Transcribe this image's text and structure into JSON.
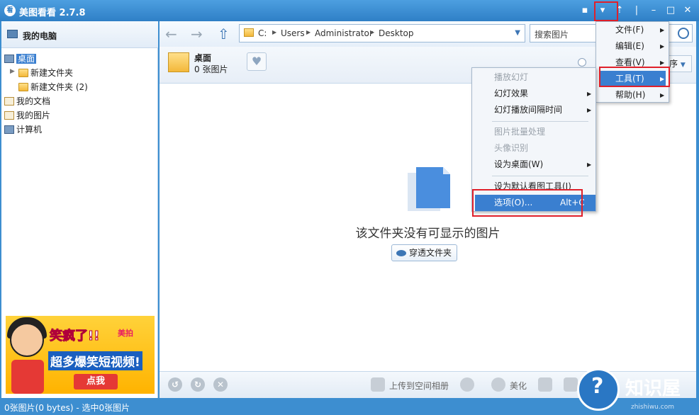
{
  "titlebar": {
    "app_icon_text": "看",
    "title": "美图看看 2.7.8"
  },
  "sidebar": {
    "header": "我的电脑",
    "items": [
      {
        "label": "桌面"
      },
      {
        "label": "新建文件夹"
      },
      {
        "label": "新建文件夹 (2)"
      },
      {
        "label": "我的文档"
      },
      {
        "label": "我的图片"
      },
      {
        "label": "计算机"
      }
    ],
    "ad": {
      "headline": "笑疯了!!",
      "brand": "美拍",
      "tagline": "超多爆笑短视频!",
      "button": "点我"
    }
  },
  "navbar": {
    "path": [
      "C:",
      "Users",
      "Administrator",
      "Desktop"
    ],
    "search_placeholder": "搜索图片"
  },
  "info": {
    "location_name": "桌面",
    "location_count": "0 张图片",
    "sort_label": "序"
  },
  "content": {
    "empty_message": "该文件夹没有可显示的图片",
    "traverse_button": "穿透文件夹"
  },
  "bottombar": {
    "upload_label": "上传到空间相册",
    "beautify_label": "美化"
  },
  "status": {
    "text": "0张图片(0 bytes) - 选中0张图片"
  },
  "main_menu": [
    {
      "label": "文件(F)"
    },
    {
      "label": "编辑(E)"
    },
    {
      "label": "查看(V)"
    },
    {
      "label": "工具(T)"
    },
    {
      "label": "帮助(H)"
    }
  ],
  "tools_menu": [
    {
      "label": "播放幻灯"
    },
    {
      "label": "幻灯效果"
    },
    {
      "label": "幻灯播放间隔时间"
    },
    {
      "label": "图片批量处理"
    },
    {
      "label": "头像识别"
    },
    {
      "label": "设为桌面(W)"
    },
    {
      "label": "设为默认看图工具(I)"
    },
    {
      "label": "选项(O)...",
      "shortcut": "Alt+C"
    }
  ],
  "watermark": {
    "name": "知识屋",
    "url": "zhishiwu.com"
  }
}
